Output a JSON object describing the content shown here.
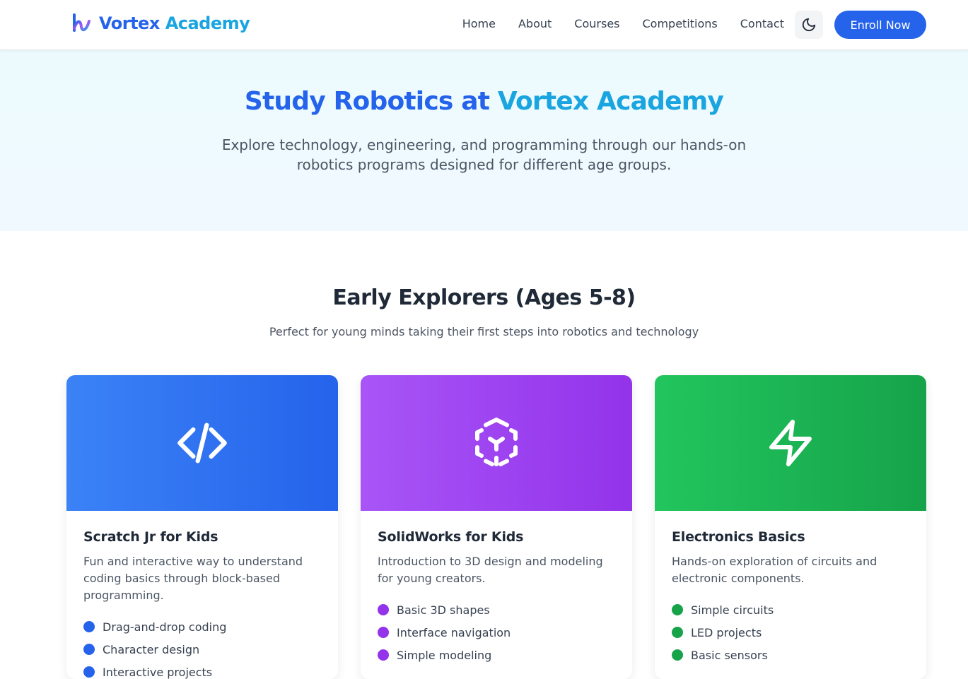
{
  "nav": {
    "brand_part1": "Vortex",
    "brand_part2": "Academy",
    "links": [
      "Home",
      "About",
      "Courses",
      "Competitions",
      "Contact"
    ],
    "theme_toggle_icon": "moon-icon",
    "enroll_label": "Enroll Now"
  },
  "hero": {
    "title_part1": "Study Robotics at",
    "title_part2": "Vortex Academy",
    "subtitle": "Explore technology, engineering, and programming through our hands-on robotics programs designed for different age groups."
  },
  "section": {
    "title": "Early Explorers (Ages 5-8)",
    "subtitle": "Perfect for young minds taking their first steps into robotics and technology"
  },
  "cards": [
    {
      "title": "Scratch Jr for Kids",
      "description": "Fun and interactive way to understand coding basics through block-based programming.",
      "icon": "code-icon",
      "accent": "#2563eb",
      "gradient_from": "#3b82f6",
      "gradient_to": "#2563eb",
      "features": [
        "Drag-and-drop coding",
        "Character design",
        "Interactive projects"
      ]
    },
    {
      "title": "SolidWorks for Kids",
      "description": "Introduction to 3D design and modeling for young creators.",
      "icon": "cube-icon",
      "accent": "#9333ea",
      "gradient_from": "#a855f7",
      "gradient_to": "#9333ea",
      "features": [
        "Basic 3D shapes",
        "Interface navigation",
        "Simple modeling"
      ]
    },
    {
      "title": "Electronics Basics",
      "description": "Hands-on exploration of circuits and electronic components.",
      "icon": "lightning-icon",
      "accent": "#16a34a",
      "gradient_from": "#22c55e",
      "gradient_to": "#16a34a",
      "features": [
        "Simple circuits",
        "LED projects",
        "Basic sensors"
      ]
    }
  ]
}
